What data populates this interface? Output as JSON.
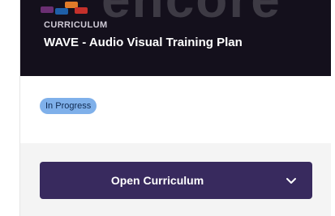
{
  "banner": {
    "watermark_text": "encore",
    "eyebrow": "CURRICULUM",
    "title": "WAVE - Audio Visual Training Plan"
  },
  "status": {
    "label": "In Progress",
    "color": "#7fb0ea"
  },
  "actions": {
    "open_label": "Open Curriculum",
    "dropdown_icon": "chevron-down-icon",
    "button_color": "#382a5e"
  }
}
